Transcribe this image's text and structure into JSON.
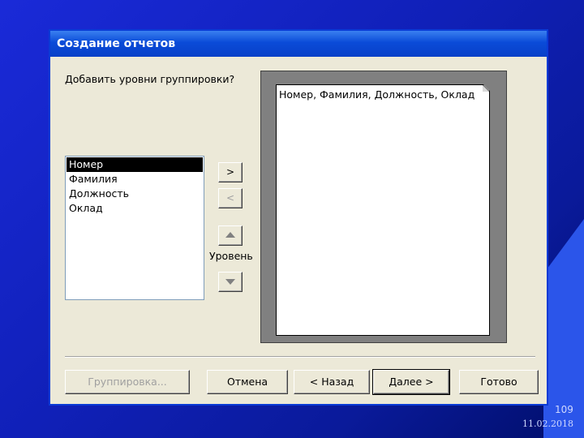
{
  "dialog": {
    "title": "Создание отчетов",
    "prompt": "Добавить уровни группировки?",
    "fields": [
      "Номер",
      "Фамилия",
      "Должность",
      "Оклад"
    ],
    "selected_field": "Номер",
    "add_button": ">",
    "remove_button": "<",
    "level_label": "Уровень",
    "preview_text": "Номер, Фамилия, Должность, Оклад",
    "buttons": {
      "grouping": "Группировка...",
      "cancel": "Отмена",
      "back": "< Назад",
      "next": "Далее >",
      "finish": "Готово"
    },
    "icons": {
      "level_up": "arrow-up-icon",
      "level_down": "arrow-down-icon"
    }
  },
  "slide": {
    "number": "109",
    "date": "11.02.2018"
  }
}
